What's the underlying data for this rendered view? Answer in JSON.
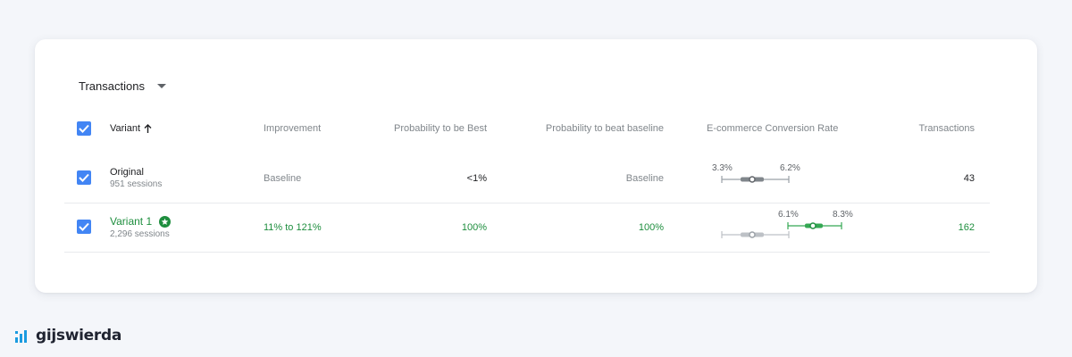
{
  "metric_selector": {
    "label": "Transactions"
  },
  "table": {
    "headers": {
      "variant": "Variant",
      "improvement": "Improvement",
      "prob_best": "Probability to be Best",
      "prob_beat": "Probability to beat baseline",
      "conv_rate": "E-commerce Conversion Rate",
      "transactions": "Transactions"
    },
    "rows": [
      {
        "name": "Original",
        "sessions": "951 sessions",
        "improvement": "Baseline",
        "prob_best": "<1%",
        "prob_beat": "Baseline",
        "ci_low": "3.3%",
        "ci_high": "6.2%",
        "transactions": "43"
      },
      {
        "name": "Variant 1",
        "sessions": "2,296 sessions",
        "improvement": "11% to 121%",
        "prob_best": "100%",
        "prob_beat": "100%",
        "ci_low": "6.1%",
        "ci_high": "8.3%",
        "transactions": "162"
      }
    ]
  },
  "brand": {
    "name": "gijswierda"
  },
  "colors": {
    "checkbox": "#4285f4",
    "winner_green": "#1e8e3e",
    "baseline_grey": "#9aa0a6",
    "brand_blue": "#1a9be0"
  }
}
